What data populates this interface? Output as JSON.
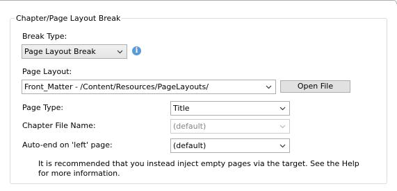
{
  "group": {
    "title": "Chapter/Page Layout Break"
  },
  "break_type": {
    "label": "Break Type:",
    "value": "Page Layout Break"
  },
  "page_layout": {
    "label": "Page Layout:",
    "value": "Front_Matter - /Content/Resources/PageLayouts/",
    "open_file_label": "Open File"
  },
  "page_type": {
    "label": "Page Type:",
    "value": "Title"
  },
  "chapter_file_name": {
    "label": "Chapter File Name:",
    "value": "(default)",
    "disabled": true
  },
  "auto_end": {
    "label": "Auto-end on 'left' page:",
    "value": "(default)"
  },
  "note": {
    "text": "It is recommended that you instead inject empty pages via the target.  See the Help for more information."
  },
  "colors": {
    "info_icon": "#5b9bd5",
    "border": "#acacac",
    "disabled_text": "#838383"
  },
  "icons": {
    "info": "info-icon",
    "dropdown": "chevron-down-icon"
  }
}
